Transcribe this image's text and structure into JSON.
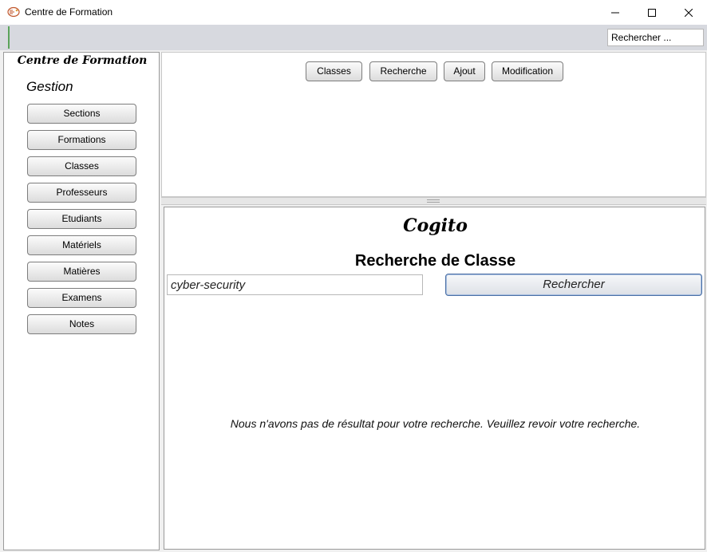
{
  "window": {
    "title": "Centre de Formation",
    "icon": "app-logo-icon"
  },
  "toolbar": {
    "search_placeholder": "Rechercher ..."
  },
  "sidebar": {
    "brand": "Centre de Formation",
    "section_title": "Gestion",
    "items": [
      {
        "label": "Sections"
      },
      {
        "label": "Formations"
      },
      {
        "label": "Classes"
      },
      {
        "label": "Professeurs"
      },
      {
        "label": "Etudiants"
      },
      {
        "label": "Matériels"
      },
      {
        "label": "Matières"
      },
      {
        "label": "Examens"
      },
      {
        "label": "Notes"
      }
    ]
  },
  "tabs": [
    {
      "label": "Classes"
    },
    {
      "label": "Recherche"
    },
    {
      "label": "Ajout"
    },
    {
      "label": "Modification"
    }
  ],
  "main": {
    "brand": "Cogito",
    "heading": "Recherche de Classe",
    "search_value": "cyber-security",
    "search_button": "Rechercher",
    "no_result_message": "Nous n'avons pas de résultat pour votre recherche.  Veuillez revoir votre recherche."
  },
  "colors": {
    "accent_focus_border": "#4a6fa5",
    "toolbar_bg": "#d7d9df"
  }
}
